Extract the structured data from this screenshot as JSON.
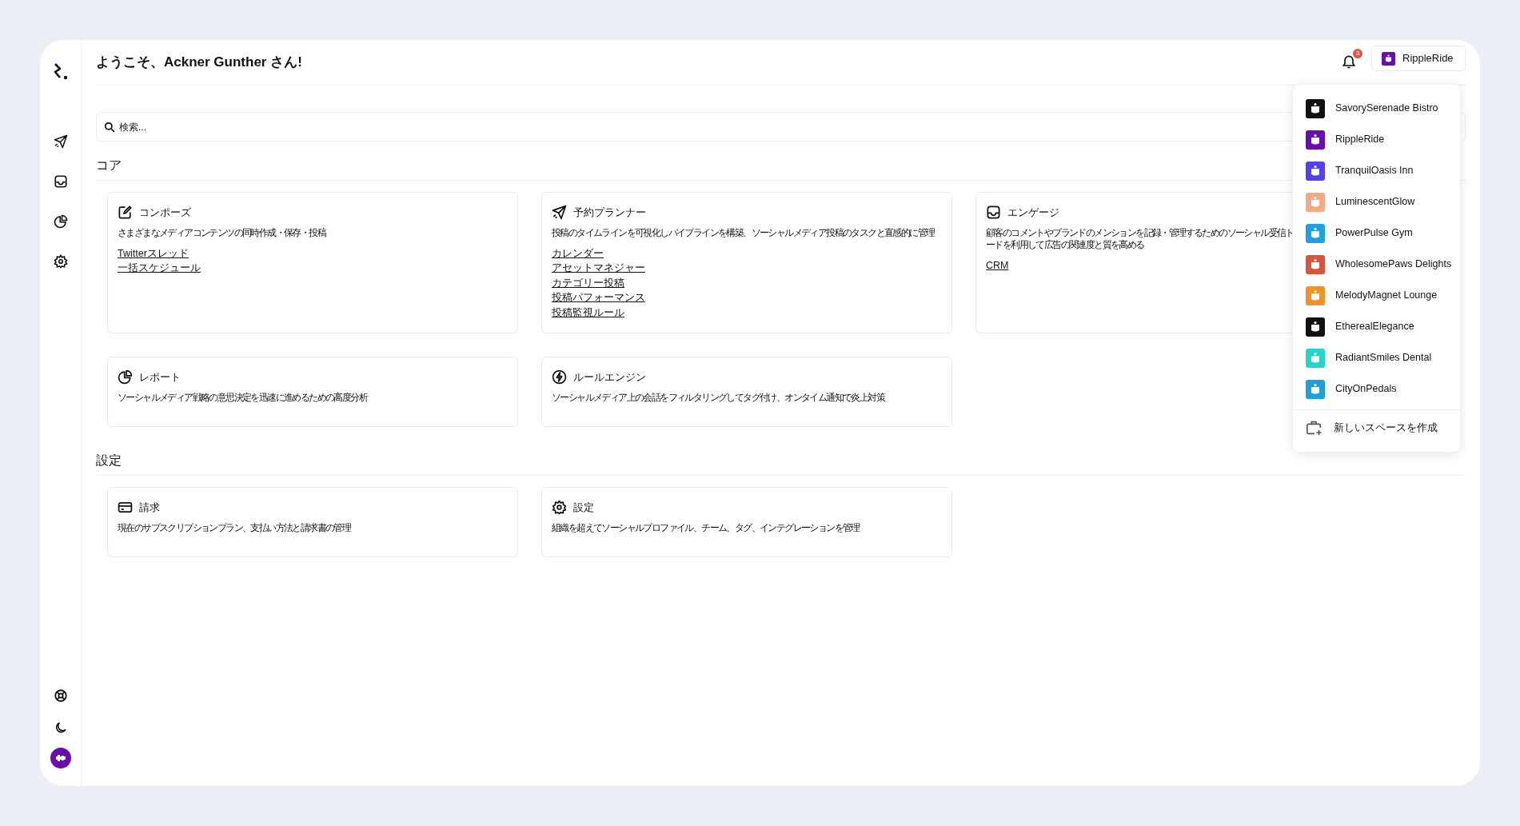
{
  "header": {
    "greeting": "ようこそ、Ackner Gunther さん!",
    "notification_count": "3",
    "current_space": {
      "name": "RippleRide",
      "color": "#6a0dad"
    }
  },
  "search": {
    "placeholder": "検索..."
  },
  "sections": [
    {
      "title": "コア",
      "cards": [
        {
          "kind": "compose",
          "title": "コンポーズ",
          "description_lines": [
            "さまざまなメディアコンテンツの同時作成・保存・投稿"
          ],
          "links": [
            "Twitterスレッド",
            "一括スケジュール"
          ]
        },
        {
          "kind": "planner",
          "title": "予約プランナー",
          "description_lines": [
            "投稿のタイムラインを可視化しパイプラインを構築、ソーシャルメディア投稿のタスクと直感的に管理"
          ],
          "links": [
            "カレンダー",
            "アセットマネジャー",
            "カテゴリー投稿",
            "投稿パフォーマンス",
            "投稿監視ルール"
          ]
        },
        {
          "kind": "engage",
          "title": "エンゲージ",
          "description_lines": [
            "顧客のコメントやブランドのメンションを記録・管理するためのソーシャル受信ト",
            "ードを利用して広告の関連度と質を高める"
          ],
          "links": [
            "CRM"
          ]
        },
        {
          "kind": "report",
          "title": "レポート",
          "description_lines": [
            "ソーシャルメディア戦略の意思決定を迅速に進めるための高度分析"
          ]
        },
        {
          "kind": "rules",
          "title": "ルールエンジン",
          "description_lines": [
            "ソーシャルメディア上の会話をフィルタリングしてタグ付け、オンタイム通知で炎上対策"
          ]
        }
      ]
    },
    {
      "title": "設定",
      "cards": [
        {
          "kind": "billing",
          "title": "請求",
          "description_lines": [
            "現在のサブスクリプションプラン、支払い方法と請求書の管理"
          ]
        },
        {
          "kind": "settings",
          "title": "設定",
          "description_lines": [
            "組織を超えてソーシャルプロファイル、チーム、タグ、インテグレーションを管理"
          ]
        }
      ]
    }
  ],
  "space_menu": {
    "spaces": [
      {
        "name": "SavorySerenade Bistro",
        "color": "#111111"
      },
      {
        "name": "RippleRide",
        "color": "#6a0dad"
      },
      {
        "name": "TranquilOasis Inn",
        "color": "#5440f0"
      },
      {
        "name": "LuminescentGlow",
        "color": "#f4a886"
      },
      {
        "name": "PowerPulse Gym",
        "color": "#1ea1e2"
      },
      {
        "name": "WholesomePaws Delights",
        "color": "#d8553e"
      },
      {
        "name": "MelodyMagnet Lounge",
        "color": "#f0922a"
      },
      {
        "name": "EtherealElegance",
        "color": "#111111"
      },
      {
        "name": "RadiantSmiles Dental",
        "color": "#20d8c8"
      },
      {
        "name": "CityOnPedals",
        "color": "#1d9fdc"
      }
    ],
    "create_label": "新しいスペースを作成"
  }
}
